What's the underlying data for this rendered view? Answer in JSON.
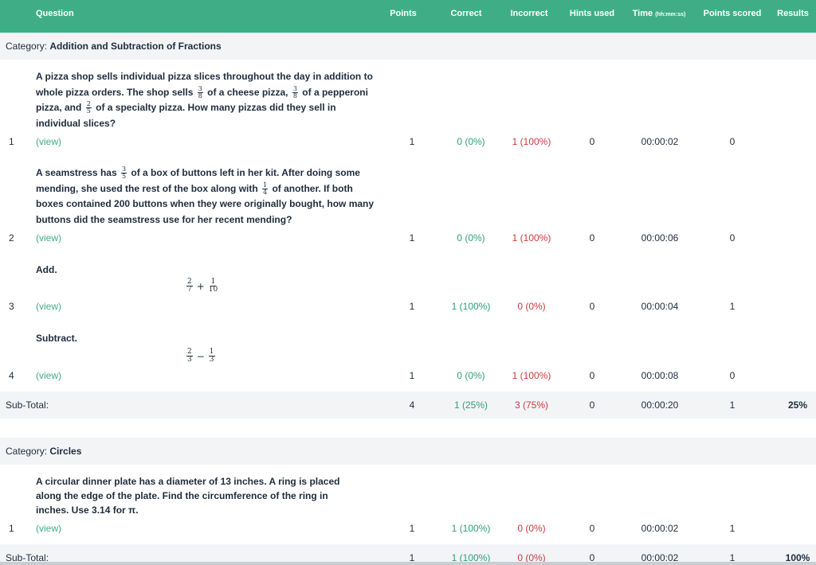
{
  "header": {
    "question": "Question",
    "points": "Points",
    "correct": "Correct",
    "incorrect": "Incorrect",
    "hints_used": "Hints used",
    "time": "Time",
    "time_format": "(hh:mm:ss)",
    "points_scored": "Points scored",
    "results": "Results"
  },
  "category_prefix": "Category: ",
  "view_label": "(view)",
  "subtotal_label": "Sub-Total:",
  "categories": [
    {
      "name": "Addition and Subtraction of Fractions",
      "questions": [
        {
          "num": "1",
          "text_parts": [
            "A pizza shop sells individual pizza slices throughout the day in addition to whole pizza orders. The shop sells ",
            " of a cheese pizza, ",
            " of a pepperoni pizza, and ",
            " of a specialty pizza. How many pizzas did they sell in individual slices?"
          ],
          "fractions": [
            [
              "3",
              "8"
            ],
            [
              "3",
              "8"
            ],
            [
              "2",
              "5"
            ]
          ],
          "points": "1",
          "correct": "0 (0%)",
          "incorrect": "1 (100%)",
          "hints": "0",
          "time": "00:00:02",
          "scored": "0"
        },
        {
          "num": "2",
          "text_parts": [
            "A seamstress has ",
            " of a box of buttons left in her kit. After doing some mending, she used the rest of the box along with ",
            " of another. If both boxes contained 200 buttons when they were originally bought, how many buttons did the seamstress use for her recent mending?"
          ],
          "fractions": [
            [
              "3",
              "5"
            ],
            [
              "1",
              "4"
            ]
          ],
          "points": "1",
          "correct": "0 (0%)",
          "incorrect": "1 (100%)",
          "hints": "0",
          "time": "00:00:06",
          "scored": "0"
        },
        {
          "num": "3",
          "text": "Add.",
          "math": {
            "a": [
              "2",
              "7"
            ],
            "op": "+",
            "b": [
              "1",
              "10"
            ]
          },
          "points": "1",
          "correct": "1 (100%)",
          "incorrect": "0 (0%)",
          "hints": "0",
          "time": "00:00:04",
          "scored": "1"
        },
        {
          "num": "4",
          "text": "Subtract.",
          "math": {
            "a": [
              "2",
              "3"
            ],
            "op": "−",
            "b": [
              "1",
              "3"
            ]
          },
          "points": "1",
          "correct": "0 (0%)",
          "incorrect": "1 (100%)",
          "hints": "0",
          "time": "00:00:08",
          "scored": "0"
        }
      ],
      "subtotal": {
        "points": "4",
        "correct": "1 (25%)",
        "incorrect": "3 (75%)",
        "hints": "0",
        "time": "00:00:20",
        "scored": "1",
        "result": "25%"
      }
    },
    {
      "name": "Circles",
      "questions": [
        {
          "num": "1",
          "text": "A circular dinner plate has a diameter of 13 inches. A ring is placed along the edge of the plate. Find the circumference of the ring in inches. Use 3.14 for π.",
          "points": "1",
          "correct": "1 (100%)",
          "incorrect": "0 (0%)",
          "hints": "0",
          "time": "00:00:02",
          "scored": "1"
        }
      ],
      "subtotal": {
        "points": "1",
        "correct": "1 (100%)",
        "incorrect": "0 (0%)",
        "hints": "0",
        "time": "00:00:02",
        "scored": "1",
        "result": "100%"
      }
    }
  ],
  "colors": {
    "header_bg": "#3fae86",
    "correct": "#2e9f78",
    "incorrect": "#d0393e",
    "row_alt": "#f2f4f6"
  }
}
